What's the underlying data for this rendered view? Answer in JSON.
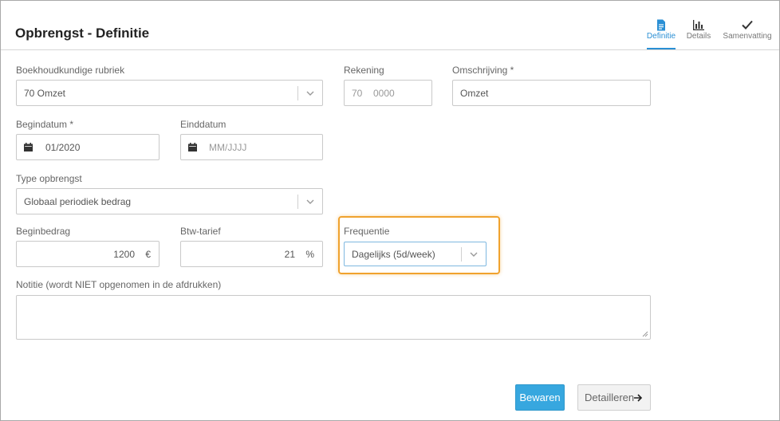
{
  "header": {
    "title": "Opbrengst - Definitie"
  },
  "steps": [
    {
      "label": "Definitie",
      "icon": "document-icon",
      "active": true
    },
    {
      "label": "Details",
      "icon": "bar-chart-icon",
      "active": false
    },
    {
      "label": "Samenvatting",
      "icon": "checkmark-icon",
      "active": false
    }
  ],
  "form": {
    "rubriek": {
      "label": "Boekhoudkundige rubriek",
      "value": "70 Omzet"
    },
    "rekening": {
      "label": "Rekening",
      "prefix": "70",
      "value": "0000"
    },
    "omschrijving": {
      "label": "Omschrijving *",
      "value": "Omzet"
    },
    "begindatum": {
      "label": "Begindatum *",
      "value": "01/2020"
    },
    "einddatum": {
      "label": "Einddatum",
      "placeholder": "MM/JJJJ"
    },
    "type": {
      "label": "Type opbrengst",
      "value": "Globaal periodiek bedrag"
    },
    "beginbedrag": {
      "label": "Beginbedrag",
      "value": "1200",
      "suffix": "€"
    },
    "btw": {
      "label": "Btw-tarief",
      "value": "21",
      "suffix": "%"
    },
    "frequentie": {
      "label": "Frequentie",
      "value": "Dagelijks (5d/week)"
    },
    "notitie": {
      "label": "Notitie (wordt NIET opgenomen in de afdrukken)",
      "value": ""
    }
  },
  "buttons": {
    "save": "Bewaren",
    "next": "Detailleren"
  },
  "colors": {
    "accent": "#2a8fd4",
    "primary_button": "#37a7df",
    "highlight": "#f0a22e"
  }
}
